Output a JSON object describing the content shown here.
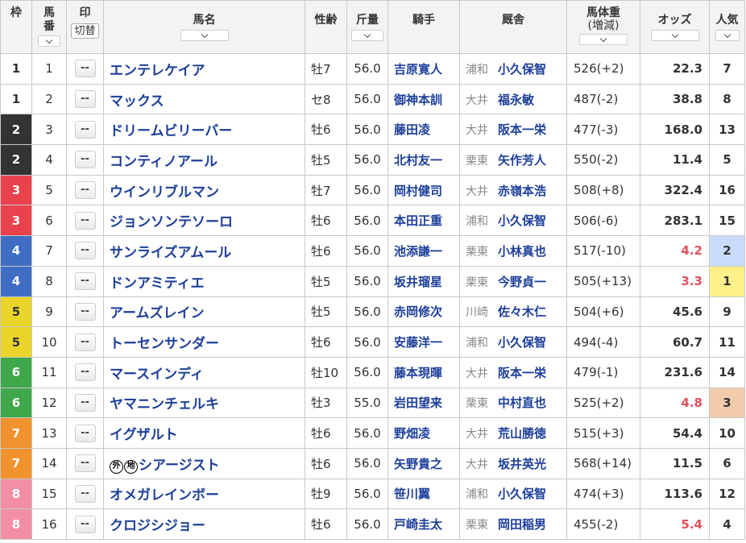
{
  "headers": {
    "waku": "枠",
    "umaban": "馬番",
    "mark": "印",
    "mark_switch": "切替",
    "name": "馬名",
    "sexage": "性齢",
    "weight": "斤量",
    "jockey": "騎手",
    "stable": "厩舎",
    "bodyweight": "馬体重",
    "bodyweight_sub": "(増減)",
    "odds": "オッズ",
    "popularity": "人気"
  },
  "mark_placeholder": "--",
  "waku_colors": {
    "1": {
      "bg": "#ffffff",
      "fg": "#333333"
    },
    "2": {
      "bg": "#333333",
      "fg": "#ffffff"
    },
    "3": {
      "bg": "#e8434d",
      "fg": "#ffffff"
    },
    "4": {
      "bg": "#3f6dc4",
      "fg": "#ffffff"
    },
    "5": {
      "bg": "#ead52a",
      "fg": "#333333"
    },
    "6": {
      "bg": "#3ea84a",
      "fg": "#ffffff"
    },
    "7": {
      "bg": "#f0922d",
      "fg": "#ffffff"
    },
    "8": {
      "bg": "#f28fa5",
      "fg": "#ffffff"
    }
  },
  "rows": [
    {
      "waku": "1",
      "umaban": "1",
      "name": "エンテレケイア",
      "badges": [],
      "sexage": "牡7",
      "weight": "56.0",
      "jockey": "吉原寛人",
      "region": "浦和",
      "trainer": "小久保智",
      "bodyweight": "526(+2)",
      "odds": "22.3",
      "pop": "7"
    },
    {
      "waku": "1",
      "umaban": "2",
      "name": "マックス",
      "badges": [],
      "sexage": "セ8",
      "weight": "56.0",
      "jockey": "御神本訓",
      "region": "大井",
      "trainer": "福永敏",
      "bodyweight": "487(-2)",
      "odds": "38.8",
      "pop": "8"
    },
    {
      "waku": "2",
      "umaban": "3",
      "name": "ドリームビリーバー",
      "badges": [],
      "sexage": "牡6",
      "weight": "56.0",
      "jockey": "藤田凌",
      "region": "大井",
      "trainer": "阪本一栄",
      "bodyweight": "477(-3)",
      "odds": "168.0",
      "pop": "13"
    },
    {
      "waku": "2",
      "umaban": "4",
      "name": "コンティノアール",
      "badges": [],
      "sexage": "牡5",
      "weight": "56.0",
      "jockey": "北村友一",
      "region": "栗東",
      "trainer": "矢作芳人",
      "bodyweight": "550(-2)",
      "odds": "11.4",
      "pop": "5"
    },
    {
      "waku": "3",
      "umaban": "5",
      "name": "ウインリブルマン",
      "badges": [],
      "sexage": "牡7",
      "weight": "56.0",
      "jockey": "岡村健司",
      "region": "大井",
      "trainer": "赤嶺本浩",
      "bodyweight": "508(+8)",
      "odds": "322.4",
      "pop": "16"
    },
    {
      "waku": "3",
      "umaban": "6",
      "name": "ジョンソンテソーロ",
      "badges": [],
      "sexage": "牡6",
      "weight": "56.0",
      "jockey": "本田正重",
      "region": "浦和",
      "trainer": "小久保智",
      "bodyweight": "506(-6)",
      "odds": "283.1",
      "pop": "15"
    },
    {
      "waku": "4",
      "umaban": "7",
      "name": "サンライズアムール",
      "badges": [],
      "sexage": "牡6",
      "weight": "56.0",
      "jockey": "池添謙一",
      "region": "栗東",
      "trainer": "小林真也",
      "bodyweight": "517(-10)",
      "odds": "4.2",
      "pop": "2"
    },
    {
      "waku": "4",
      "umaban": "8",
      "name": "ドンアミティエ",
      "badges": [],
      "sexage": "牡5",
      "weight": "56.0",
      "jockey": "坂井瑠星",
      "region": "栗東",
      "trainer": "今野貞一",
      "bodyweight": "505(+13)",
      "odds": "3.3",
      "pop": "1"
    },
    {
      "waku": "5",
      "umaban": "9",
      "name": "アームズレイン",
      "badges": [],
      "sexage": "牡5",
      "weight": "56.0",
      "jockey": "赤岡修次",
      "region": "川崎",
      "trainer": "佐々木仁",
      "bodyweight": "504(+6)",
      "odds": "45.6",
      "pop": "9"
    },
    {
      "waku": "5",
      "umaban": "10",
      "name": "トーセンサンダー",
      "badges": [],
      "sexage": "牡6",
      "weight": "56.0",
      "jockey": "安藤洋一",
      "region": "浦和",
      "trainer": "小久保智",
      "bodyweight": "494(-4)",
      "odds": "60.7",
      "pop": "11"
    },
    {
      "waku": "6",
      "umaban": "11",
      "name": "マースインディ",
      "badges": [],
      "sexage": "牡10",
      "weight": "56.0",
      "jockey": "藤本現暉",
      "region": "大井",
      "trainer": "阪本一栄",
      "bodyweight": "479(-1)",
      "odds": "231.6",
      "pop": "14"
    },
    {
      "waku": "6",
      "umaban": "12",
      "name": "ヤマニンチェルキ",
      "badges": [],
      "sexage": "牡3",
      "weight": "55.0",
      "jockey": "岩田望来",
      "region": "栗東",
      "trainer": "中村直也",
      "bodyweight": "525(+2)",
      "odds": "4.8",
      "pop": "3"
    },
    {
      "waku": "7",
      "umaban": "13",
      "name": "イグザルト",
      "badges": [],
      "sexage": "牡6",
      "weight": "56.0",
      "jockey": "野畑凌",
      "region": "大井",
      "trainer": "荒山勝徳",
      "bodyweight": "515(+3)",
      "odds": "54.4",
      "pop": "10"
    },
    {
      "waku": "7",
      "umaban": "14",
      "name": "シアージスト",
      "badges": [
        "外",
        "地"
      ],
      "sexage": "牡6",
      "weight": "56.0",
      "jockey": "矢野貴之",
      "region": "大井",
      "trainer": "坂井英光",
      "bodyweight": "568(+14)",
      "odds": "11.5",
      "pop": "6"
    },
    {
      "waku": "8",
      "umaban": "15",
      "name": "オメガレインボー",
      "badges": [],
      "sexage": "牡9",
      "weight": "56.0",
      "jockey": "笹川翼",
      "region": "浦和",
      "trainer": "小久保智",
      "bodyweight": "474(+3)",
      "odds": "113.6",
      "pop": "12"
    },
    {
      "waku": "8",
      "umaban": "16",
      "name": "クロジシジョー",
      "badges": [],
      "sexage": "牡6",
      "weight": "56.0",
      "jockey": "戸崎圭太",
      "region": "栗東",
      "trainer": "岡田稲男",
      "bodyweight": "455(-2)",
      "odds": "5.4",
      "pop": "4"
    }
  ],
  "highlight_colors": {
    "pop1": "#fff18a",
    "pop2": "#c9dcfb",
    "pop3": "#f3ccab",
    "hot_odds": "#e0525b",
    "link": "#1d3f9a"
  }
}
